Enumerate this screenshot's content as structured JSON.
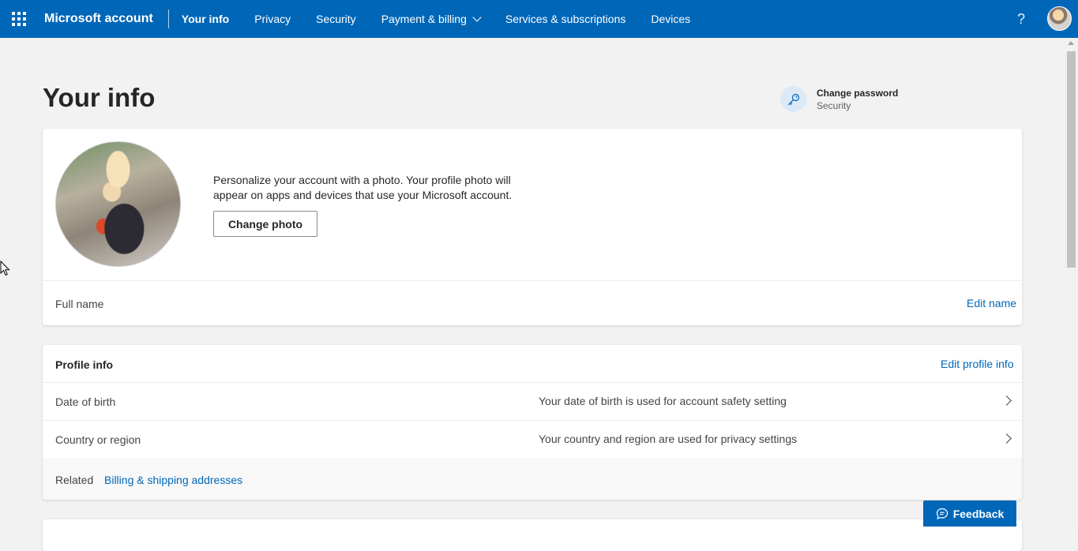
{
  "header": {
    "brand": "Microsoft account",
    "nav": [
      {
        "label": "Your info",
        "active": true
      },
      {
        "label": "Privacy"
      },
      {
        "label": "Security"
      },
      {
        "label": "Payment & billing",
        "dropdown": true
      },
      {
        "label": "Services & subscriptions"
      },
      {
        "label": "Devices"
      }
    ],
    "help_icon": "question-mark-icon",
    "help_glyph": "?",
    "accent_color": "#0067b8"
  },
  "page": {
    "title": "Your info"
  },
  "change_password": {
    "icon": "key-icon",
    "title": "Change password",
    "subtitle": "Security"
  },
  "photo_card": {
    "description": "Personalize your account with a photo. Your profile photo will appear on apps and devices that use your Microsoft account.",
    "change_photo_label": "Change photo",
    "full_name_label": "Full name",
    "edit_name_label": "Edit name"
  },
  "profile_card": {
    "title": "Profile info",
    "edit_label": "Edit profile info",
    "rows": [
      {
        "label": "Date of birth",
        "description": "Your date of birth is used for account safety setting"
      },
      {
        "label": "Country or region",
        "description": "Your country and region are used for privacy settings"
      }
    ],
    "related_label": "Related",
    "related_link": "Billing & shipping addresses"
  },
  "feedback": {
    "label": "Feedback",
    "icon": "chat-bubble-icon"
  }
}
